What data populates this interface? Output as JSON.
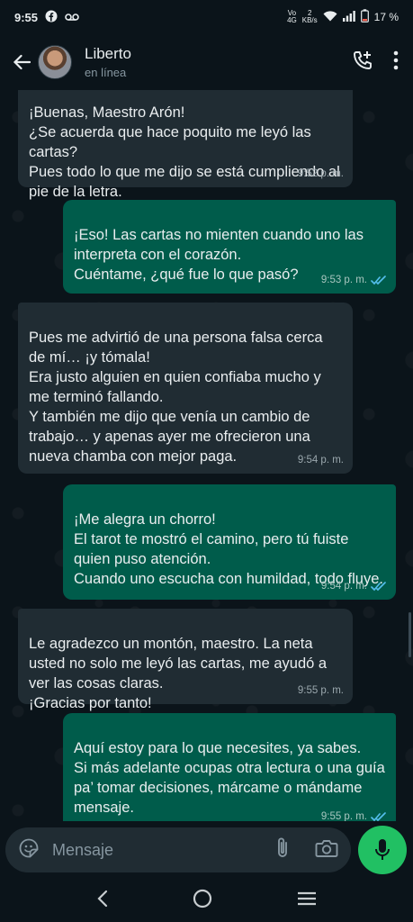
{
  "status_bar": {
    "time": "9:55",
    "network_top": "Vo",
    "network_bottom": "4G",
    "speed_top": "2",
    "speed_bottom": "KB/s",
    "battery": "17 %"
  },
  "header": {
    "contact_name": "Liberto",
    "contact_status": "en línea"
  },
  "messages": [
    {
      "direction": "in",
      "text": "¡Buenas, Maestro Arón!\n¿Se acuerda que hace poquito me leyó las cartas?\nPues todo lo que me dijo se está cumpliendo al pie de la letra.",
      "time": "9:52 p. m."
    },
    {
      "direction": "out",
      "text": "¡Eso! Las cartas no mienten cuando uno las interpreta con el corazón.\nCuéntame, ¿qué fue lo que pasó?",
      "time": "9:53 p. m."
    },
    {
      "direction": "in",
      "text": "Pues me advirtió de una persona falsa cerca de mí… ¡y tómala!\nEra justo alguien en quien confiaba mucho y me terminó fallando.\nY también me dijo que venía un cambio de trabajo… y apenas ayer me ofrecieron una nueva chamba con mejor paga.",
      "time": "9:54 p. m."
    },
    {
      "direction": "out",
      "text": "¡Me alegra un chorro!\nEl tarot te mostró el camino, pero tú fuiste quien puso atención.\nCuando uno escucha con humildad, todo fluye.",
      "time": "9:54 p. m."
    },
    {
      "direction": "in",
      "text": "Le agradezco un montón, maestro. La neta usted no solo me leyó las cartas, me ayudó a ver las cosas claras.\n¡Gracias por tanto!",
      "time": "9:55 p. m."
    },
    {
      "direction": "out",
      "text": "Aquí estoy para lo que necesites, ya sabes.\nSi más adelante ocupas otra lectura o una guía pa’ tomar decisiones, márcame o mándame mensaje.",
      "time": "9:55 p. m."
    }
  ],
  "composer": {
    "placeholder": "Mensaje"
  },
  "colors": {
    "background": "#0b141a",
    "incoming_bubble": "#202c33",
    "outgoing_bubble": "#005c4b",
    "mic_button": "#21c063",
    "read_ticks": "#53bdeb"
  }
}
